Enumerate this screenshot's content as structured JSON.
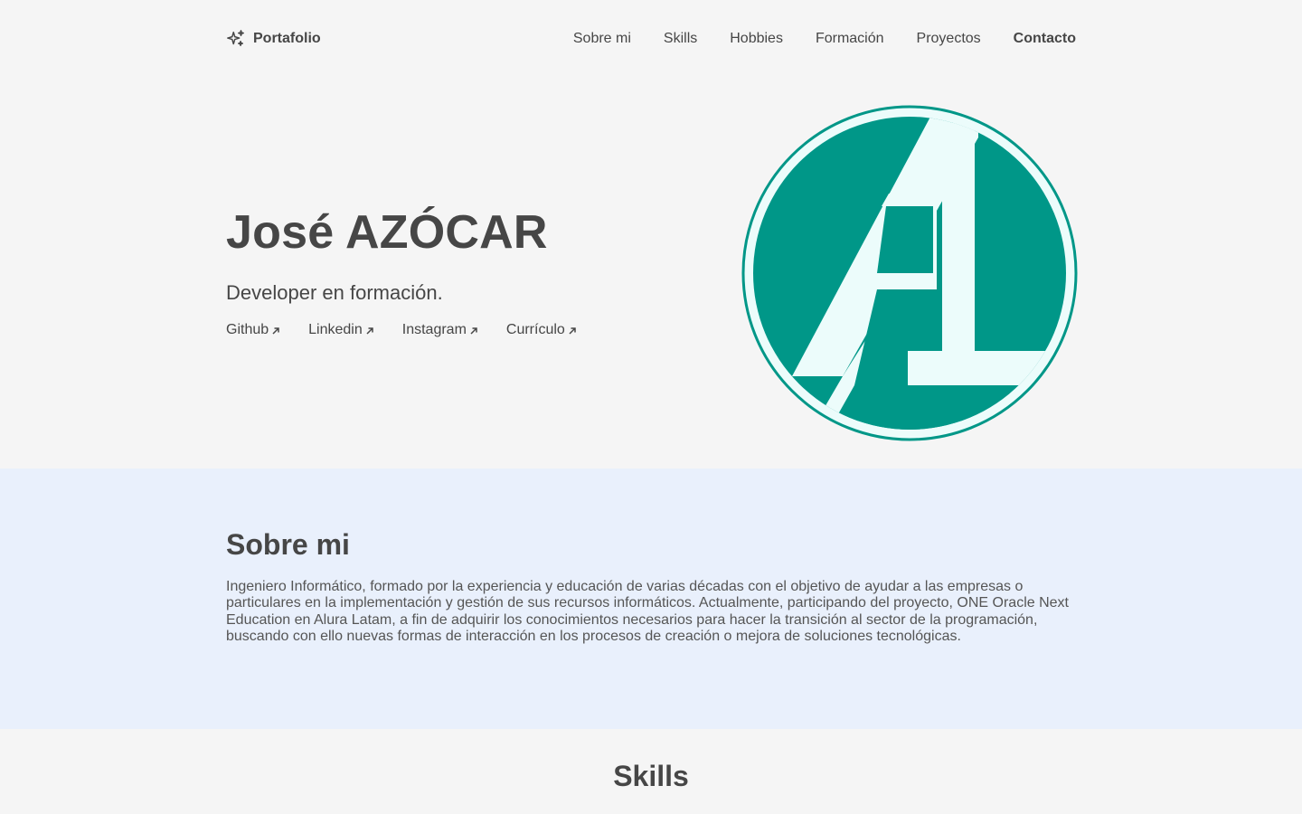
{
  "header": {
    "brand_label": "Portafolio",
    "brand_icon": "sparkles-icon",
    "nav": [
      {
        "label": "Sobre mi"
      },
      {
        "label": "Skills"
      },
      {
        "label": "Hobbies"
      },
      {
        "label": "Formación"
      },
      {
        "label": "Proyectos"
      },
      {
        "label": "Contacto",
        "active": true
      }
    ]
  },
  "hero": {
    "name": "José AZÓCAR",
    "subtitle": "Developer en formación.",
    "links": [
      {
        "label": "Github",
        "icon": "arrow-up-right-icon"
      },
      {
        "label": "Linkedin",
        "icon": "arrow-up-right-icon"
      },
      {
        "label": "Instagram",
        "icon": "arrow-up-right-icon"
      },
      {
        "label": "Currículo",
        "icon": "arrow-up-right-icon"
      }
    ],
    "logo": {
      "colors": {
        "ring": "#009788",
        "fill": "#009788",
        "glyph": "#ecfcfb"
      }
    }
  },
  "about": {
    "title": "Sobre mi",
    "text": "Ingeniero Informático, formado por la experiencia y educación de varias décadas con el objetivo de ayudar a las empresas o particulares en la implementación y gestión de sus recursos informáticos. Actualmente, participando del proyecto, ONE Oracle Next Education en Alura Latam, a fin de adquirir los conocimientos necesarios para hacer la transición al sector de la programación, buscando con ello nuevas formas de interacción en los procesos de creación o mejora de soluciones tecnológicas.",
    "background": "#e9f0fc"
  },
  "skills": {
    "title": "Skills"
  },
  "colors": {
    "page_background": "#f5f5f5",
    "text": "#464646",
    "accent": "#009788"
  }
}
